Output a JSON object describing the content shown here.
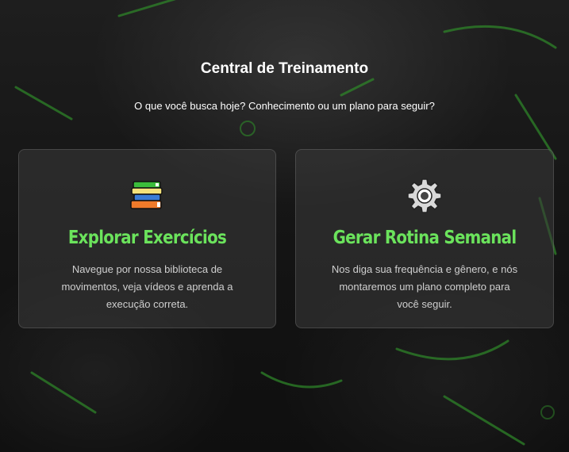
{
  "page": {
    "title": "Central de Treinamento",
    "subtitle": "O que você busca hoje? Conhecimento ou um plano para seguir?"
  },
  "cards": [
    {
      "icon": "books-icon",
      "title": "Explorar Exercícios",
      "description": "Navegue por nossa biblioteca de movimentos, veja vídeos e aprenda a execução correta."
    },
    {
      "icon": "gear-icon",
      "title": "Gerar Rotina Semanal",
      "description": "Nos diga sua frequência e gênero, e nós montaremos um plano completo para você seguir."
    }
  ],
  "colors": {
    "accent": "#6be35c",
    "background": "#161616",
    "card": "#3a3a3a"
  }
}
